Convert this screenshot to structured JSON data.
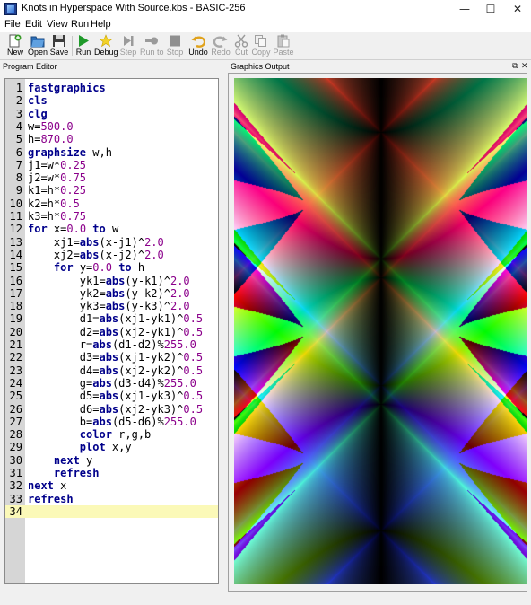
{
  "window": {
    "title": "Knots in Hyperspace With Source.kbs - BASIC-256",
    "minimize": "—",
    "maximize": "☐",
    "close": "✕"
  },
  "menu": [
    "File",
    "Edit",
    "View",
    "Run",
    "Help"
  ],
  "toolbar": [
    {
      "label": "New",
      "icon": "new-icon",
      "enabled": true
    },
    {
      "label": "Open",
      "icon": "open-folder-icon",
      "enabled": true
    },
    {
      "label": "Save",
      "icon": "save-disk-icon",
      "enabled": true
    },
    {
      "label": "Run",
      "icon": "run-play-icon",
      "enabled": true
    },
    {
      "label": "Debug",
      "icon": "debug-icon",
      "enabled": true
    },
    {
      "label": "Step",
      "icon": "step-icon",
      "enabled": false
    },
    {
      "label": "Run to",
      "icon": "run-to-icon",
      "enabled": false
    },
    {
      "label": "Stop",
      "icon": "stop-icon",
      "enabled": false
    },
    {
      "label": "Undo",
      "icon": "undo-icon",
      "enabled": true
    },
    {
      "label": "Redo",
      "icon": "redo-icon",
      "enabled": false
    },
    {
      "label": "Cut",
      "icon": "cut-scissors-icon",
      "enabled": false
    },
    {
      "label": "Copy",
      "icon": "copy-icon",
      "enabled": false
    },
    {
      "label": "Paste",
      "icon": "paste-icon",
      "enabled": false
    }
  ],
  "panels": {
    "editor_title": "Program Editor",
    "graphics_title": "Graphics Output",
    "float_icon": "⧉",
    "close_icon": "✕"
  },
  "editor": {
    "current_line": 34,
    "lines": [
      [
        [
          "kw",
          "fastgraphics"
        ]
      ],
      [
        [
          "kw",
          "cls"
        ]
      ],
      [
        [
          "kw",
          "clg"
        ]
      ],
      [
        [
          "t",
          "w="
        ],
        [
          "num",
          "500.0"
        ]
      ],
      [
        [
          "t",
          "h="
        ],
        [
          "num",
          "870.0"
        ]
      ],
      [
        [
          "kw",
          "graphsize"
        ],
        [
          "t",
          " w,h"
        ]
      ],
      [
        [
          "t",
          "j1=w*"
        ],
        [
          "num",
          "0.25"
        ]
      ],
      [
        [
          "t",
          "j2=w*"
        ],
        [
          "num",
          "0.75"
        ]
      ],
      [
        [
          "t",
          "k1=h*"
        ],
        [
          "num",
          "0.25"
        ]
      ],
      [
        [
          "t",
          "k2=h*"
        ],
        [
          "num",
          "0.5"
        ]
      ],
      [
        [
          "t",
          "k3=h*"
        ],
        [
          "num",
          "0.75"
        ]
      ],
      [
        [
          "kw",
          "for"
        ],
        [
          "t",
          " x="
        ],
        [
          "num",
          "0.0"
        ],
        [
          "t",
          " "
        ],
        [
          "kw",
          "to"
        ],
        [
          "t",
          " w"
        ]
      ],
      [
        [
          "t",
          "    xj1="
        ],
        [
          "kw",
          "abs"
        ],
        [
          "t",
          "(x-j1)^"
        ],
        [
          "num",
          "2.0"
        ]
      ],
      [
        [
          "t",
          "    xj2="
        ],
        [
          "kw",
          "abs"
        ],
        [
          "t",
          "(x-j2)^"
        ],
        [
          "num",
          "2.0"
        ]
      ],
      [
        [
          "t",
          "    "
        ],
        [
          "kw",
          "for"
        ],
        [
          "t",
          " y="
        ],
        [
          "num",
          "0.0"
        ],
        [
          "t",
          " "
        ],
        [
          "kw",
          "to"
        ],
        [
          "t",
          " h"
        ]
      ],
      [
        [
          "t",
          "        yk1="
        ],
        [
          "kw",
          "abs"
        ],
        [
          "t",
          "(y-k1)^"
        ],
        [
          "num",
          "2.0"
        ]
      ],
      [
        [
          "t",
          "        yk2="
        ],
        [
          "kw",
          "abs"
        ],
        [
          "t",
          "(y-k2)^"
        ],
        [
          "num",
          "2.0"
        ]
      ],
      [
        [
          "t",
          "        yk3="
        ],
        [
          "kw",
          "abs"
        ],
        [
          "t",
          "(y-k3)^"
        ],
        [
          "num",
          "2.0"
        ]
      ],
      [
        [
          "t",
          "        d1="
        ],
        [
          "kw",
          "abs"
        ],
        [
          "t",
          "(xj1-yk1)^"
        ],
        [
          "num",
          "0.5"
        ]
      ],
      [
        [
          "t",
          "        d2="
        ],
        [
          "kw",
          "abs"
        ],
        [
          "t",
          "(xj2-yk1)^"
        ],
        [
          "num",
          "0.5"
        ]
      ],
      [
        [
          "t",
          "        r="
        ],
        [
          "kw",
          "abs"
        ],
        [
          "t",
          "(d1-d2)%"
        ],
        [
          "num",
          "255.0"
        ]
      ],
      [
        [
          "t",
          "        d3="
        ],
        [
          "kw",
          "abs"
        ],
        [
          "t",
          "(xj1-yk2)^"
        ],
        [
          "num",
          "0.5"
        ]
      ],
      [
        [
          "t",
          "        d4="
        ],
        [
          "kw",
          "abs"
        ],
        [
          "t",
          "(xj2-yk2)^"
        ],
        [
          "num",
          "0.5"
        ]
      ],
      [
        [
          "t",
          "        g="
        ],
        [
          "kw",
          "abs"
        ],
        [
          "t",
          "(d3-d4)%"
        ],
        [
          "num",
          "255.0"
        ]
      ],
      [
        [
          "t",
          "        d5="
        ],
        [
          "kw",
          "abs"
        ],
        [
          "t",
          "(xj1-yk3)^"
        ],
        [
          "num",
          "0.5"
        ]
      ],
      [
        [
          "t",
          "        d6="
        ],
        [
          "kw",
          "abs"
        ],
        [
          "t",
          "(xj2-yk3)^"
        ],
        [
          "num",
          "0.5"
        ]
      ],
      [
        [
          "t",
          "        b="
        ],
        [
          "kw",
          "abs"
        ],
        [
          "t",
          "(d5-d6)%"
        ],
        [
          "num",
          "255.0"
        ]
      ],
      [
        [
          "t",
          "        "
        ],
        [
          "kw",
          "color"
        ],
        [
          "t",
          " r,g,b"
        ]
      ],
      [
        [
          "t",
          "        "
        ],
        [
          "kw",
          "plot"
        ],
        [
          "t",
          " x,y"
        ]
      ],
      [
        [
          "t",
          "    "
        ],
        [
          "kw",
          "next"
        ],
        [
          "t",
          " y"
        ]
      ],
      [
        [
          "t",
          "    "
        ],
        [
          "kw",
          "refresh"
        ]
      ],
      [
        [
          "kw",
          "next"
        ],
        [
          "t",
          " x"
        ]
      ],
      [
        [
          "kw",
          "refresh"
        ]
      ],
      []
    ]
  },
  "colors": {
    "keyword": "#00008b",
    "number": "#8b008b",
    "current_line": "#fbf9b8",
    "gutter": "#d6d6d6"
  }
}
